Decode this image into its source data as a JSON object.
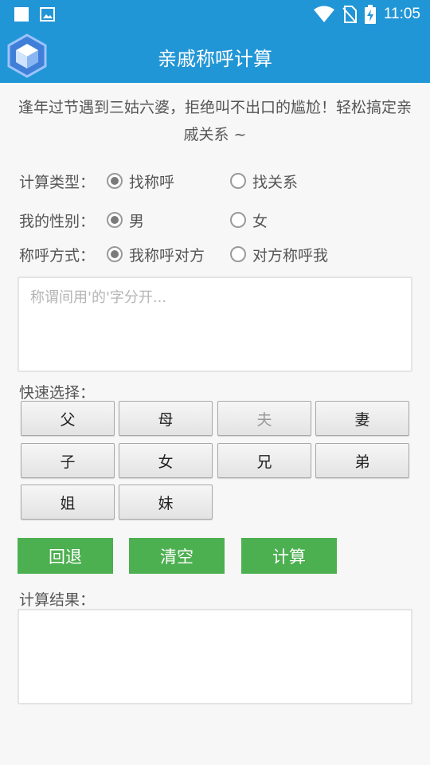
{
  "status_bar": {
    "time": "11:05",
    "icons": [
      "square-icon",
      "image-icon",
      "wifi-icon",
      "no-sim-icon",
      "battery-charging-icon"
    ]
  },
  "app_bar": {
    "title": "亲戚称呼计算",
    "logo": "cube-logo"
  },
  "intro_text": "逢年过节遇到三姑六婆，拒绝叫不出口的尴尬！轻松搞定亲戚关系 ~",
  "calc_type": {
    "label": "计算类型：",
    "options": [
      "找称呼",
      "找关系"
    ],
    "selected": 0
  },
  "gender": {
    "label": "我的性别：",
    "options": [
      "男",
      "女"
    ],
    "selected": 0
  },
  "address_mode": {
    "label": "称呼方式：",
    "options": [
      "我称呼对方",
      "对方称呼我"
    ],
    "selected": 0
  },
  "input": {
    "placeholder": "称谓间用'的'字分开...",
    "value": ""
  },
  "quick_select": {
    "label": "快速选择：",
    "buttons": [
      "父",
      "母",
      "夫",
      "妻",
      "子",
      "女",
      "兄",
      "弟",
      "姐",
      "妹"
    ],
    "disabled": [
      "夫"
    ]
  },
  "actions": {
    "back": "回退",
    "clear": "清空",
    "calculate": "计算"
  },
  "result": {
    "label": "计算结果：",
    "value": ""
  },
  "colors": {
    "primary": "#2196d6",
    "action_green": "#4caf50"
  }
}
